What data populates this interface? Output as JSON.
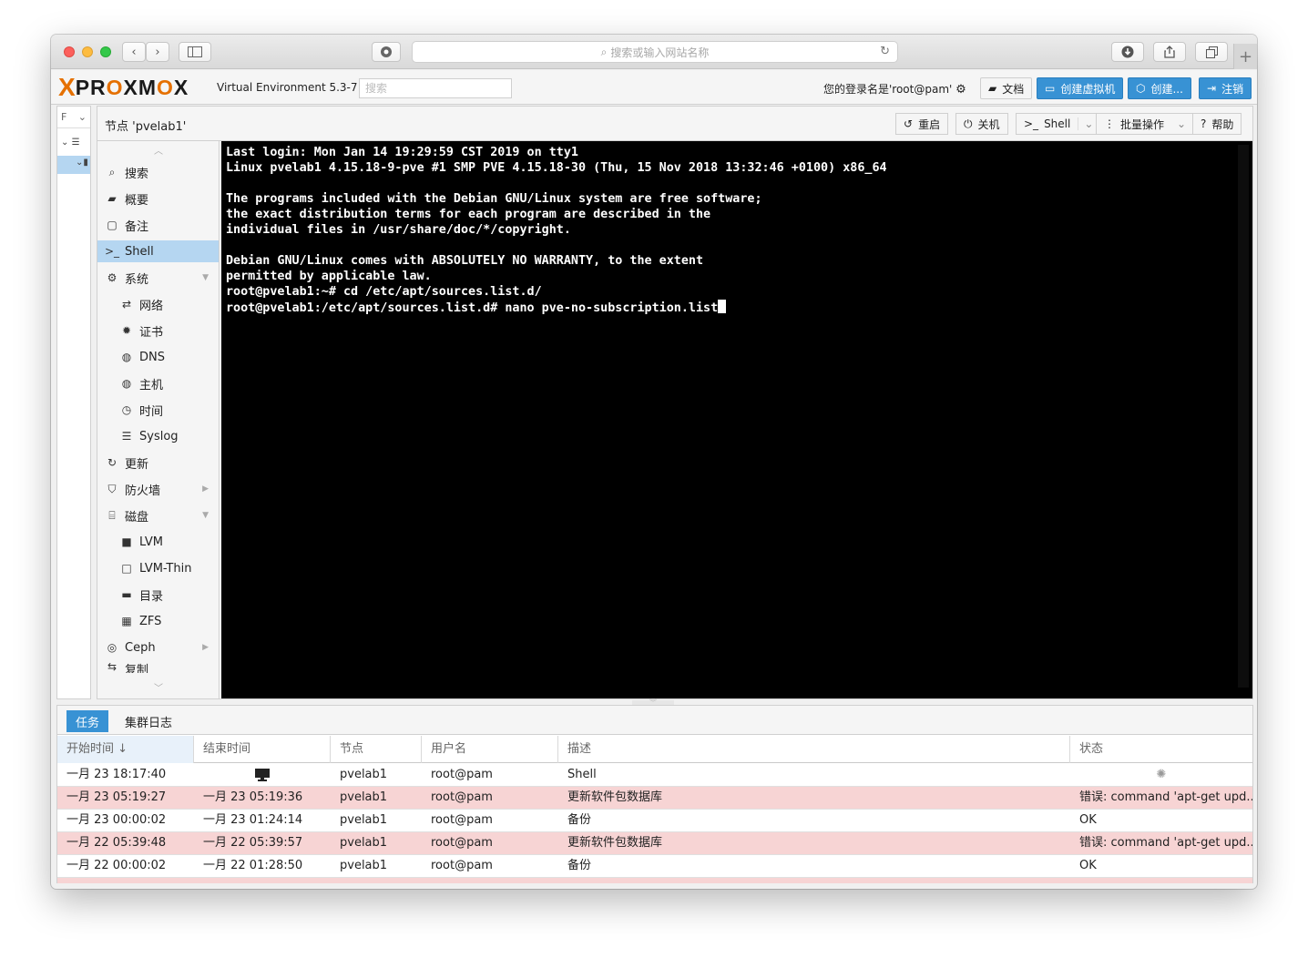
{
  "browser": {
    "url_placeholder": "搜索或输入网站名称",
    "reload_icon": "reload-icon",
    "nav_back": "‹",
    "nav_forward": "›"
  },
  "header": {
    "logo_x": "X",
    "logo_text_pre": "PR",
    "logo_text_o1": "O",
    "logo_text_mid": "XM",
    "logo_text_o2": "O",
    "logo_text_post": "X",
    "version": "Virtual Environment 5.3-7",
    "search_placeholder": "搜索",
    "login_text": "您的登录名是'root@pam'",
    "docs_label": "文档",
    "create_vm_label": "创建虚拟机",
    "create_ct_label": "创建...",
    "logout_label": "注销"
  },
  "tree": {
    "view_selector": "F"
  },
  "node_toolbar": {
    "title": "节点 'pvelab1'",
    "reboot_label": "重启",
    "shutdown_label": "关机",
    "shell_label": "Shell",
    "bulk_label": "批量操作",
    "help_label": "帮助"
  },
  "menu": {
    "items": [
      {
        "label": "搜索",
        "icon": "search-icon"
      },
      {
        "label": "概要",
        "icon": "book-icon"
      },
      {
        "label": "备注",
        "icon": "note-icon"
      },
      {
        "label": "Shell",
        "icon": "terminal-icon"
      },
      {
        "label": "系统",
        "icon": "cogs-icon"
      },
      {
        "label": "网络",
        "icon": "exchange-icon"
      },
      {
        "label": "证书",
        "icon": "certificate-icon"
      },
      {
        "label": "DNS",
        "icon": "globe-icon"
      },
      {
        "label": "主机",
        "icon": "globe-icon"
      },
      {
        "label": "时间",
        "icon": "clock-icon"
      },
      {
        "label": "Syslog",
        "icon": "list-icon"
      },
      {
        "label": "更新",
        "icon": "refresh-icon"
      },
      {
        "label": "防火墙",
        "icon": "shield-icon"
      },
      {
        "label": "磁盘",
        "icon": "hdd-icon"
      },
      {
        "label": "LVM",
        "icon": "square-icon"
      },
      {
        "label": "LVM-Thin",
        "icon": "square-outline-icon"
      },
      {
        "label": "目录",
        "icon": "folder-icon"
      },
      {
        "label": "ZFS",
        "icon": "th-large-icon"
      },
      {
        "label": "Ceph",
        "icon": "ceph-icon"
      },
      {
        "label": "复制",
        "icon": "retweet-icon"
      }
    ]
  },
  "terminal": {
    "lines": [
      "Last login: Mon Jan 14 19:29:59 CST 2019 on tty1",
      "Linux pvelab1 4.15.18-9-pve #1 SMP PVE 4.15.18-30 (Thu, 15 Nov 2018 13:32:46 +0100) x86_64",
      "",
      "The programs included with the Debian GNU/Linux system are free software;",
      "the exact distribution terms for each program are described in the",
      "individual files in /usr/share/doc/*/copyright.",
      "",
      "Debian GNU/Linux comes with ABSOLUTELY NO WARRANTY, to the extent",
      "permitted by applicable law.",
      "root@pvelab1:~# cd /etc/apt/sources.list.d/",
      "root@pvelab1:/etc/apt/sources.list.d# nano pve-no-subscription.list"
    ]
  },
  "log": {
    "tabs": [
      "任务",
      "集群日志"
    ],
    "columns": [
      "开始时间 ↓",
      "结束时间",
      "节点",
      "用户名",
      "描述",
      "状态"
    ],
    "rows": [
      {
        "start": "一月 23 18:17:40",
        "end": "",
        "node": "pvelab1",
        "user": "root@pam",
        "desc": "Shell",
        "status": "",
        "error": false,
        "running": true
      },
      {
        "start": "一月 23 05:19:27",
        "end": "一月 23 05:19:36",
        "node": "pvelab1",
        "user": "root@pam",
        "desc": "更新软件包数据库",
        "status": "错误: command 'apt-get upd...",
        "error": true,
        "running": false
      },
      {
        "start": "一月 23 00:00:02",
        "end": "一月 23 01:24:14",
        "node": "pvelab1",
        "user": "root@pam",
        "desc": "备份",
        "status": "OK",
        "error": false,
        "running": false
      },
      {
        "start": "一月 22 05:39:48",
        "end": "一月 22 05:39:57",
        "node": "pvelab1",
        "user": "root@pam",
        "desc": "更新软件包数据库",
        "status": "错误: command 'apt-get upd...",
        "error": true,
        "running": false
      },
      {
        "start": "一月 22 00:00:02",
        "end": "一月 22 01:28:50",
        "node": "pvelab1",
        "user": "root@pam",
        "desc": "备份",
        "status": "OK",
        "error": false,
        "running": false
      }
    ]
  },
  "colors": {
    "accent": "#3892d4",
    "brand_orange": "#e57000",
    "menu_selected": "#b5d6f1",
    "error_row": "#f7d4d4"
  }
}
